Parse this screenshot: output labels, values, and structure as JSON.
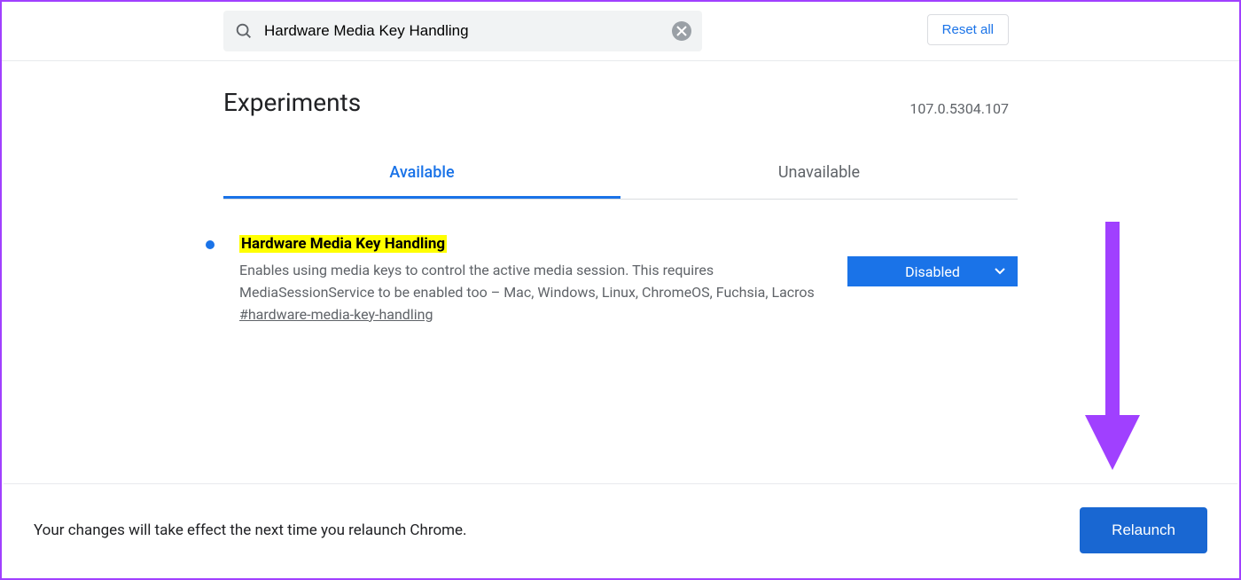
{
  "search": {
    "value": "Hardware Media Key Handling"
  },
  "reset_label": "Reset all",
  "page_title": "Experiments",
  "version": "107.0.5304.107",
  "tabs": {
    "available": "Available",
    "unavailable": "Unavailable"
  },
  "flag": {
    "title": "Hardware Media Key Handling",
    "description": "Enables using media keys to control the active media session. This requires MediaSessionService to be enabled too – Mac, Windows, Linux, ChromeOS, Fuchsia, Lacros",
    "hash": "#hardware-media-key-handling",
    "selected": "Disabled"
  },
  "bottom": {
    "message": "Your changes will take effect the next time you relaunch Chrome.",
    "button": "Relaunch"
  }
}
